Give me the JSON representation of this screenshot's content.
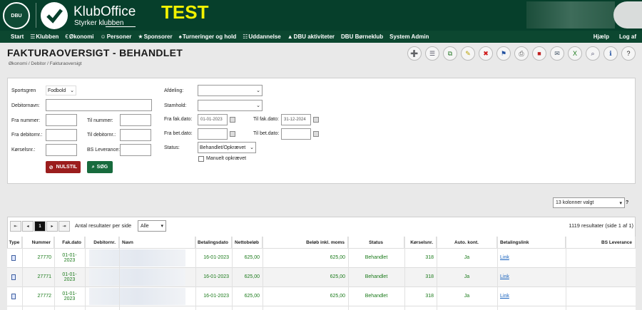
{
  "header": {
    "dbu_logo_text": "DBU",
    "app_name": "KlubOffice",
    "tagline": "Styrker klubben",
    "env_badge": "TEST"
  },
  "nav": {
    "items": [
      {
        "icon": "",
        "label": "Start"
      },
      {
        "icon": "☰",
        "label": "Klubben"
      },
      {
        "icon": "€",
        "label": "Økonomi"
      },
      {
        "icon": "☺",
        "label": "Personer"
      },
      {
        "icon": "★",
        "label": "Sponsorer"
      },
      {
        "icon": "♠",
        "label": "Turneringer og hold"
      },
      {
        "icon": "☷",
        "label": "Uddannelse"
      },
      {
        "icon": "▲",
        "label": "DBU aktiviteter"
      },
      {
        "icon": "",
        "label": "DBU Børneklub"
      },
      {
        "icon": "",
        "label": "System Admin"
      }
    ],
    "help": "Hjælp",
    "logout": "Log af"
  },
  "page": {
    "title": "FAKTURAOVERSIGT - BEHANDLET",
    "breadcrumb": "Økonomi / Debitor / Fakturaoversigt"
  },
  "toolbar": [
    {
      "icon": "add-icon",
      "glyph": "➕",
      "color": "#2a9a2a"
    },
    {
      "icon": "document-icon",
      "glyph": "☰",
      "color": "#556"
    },
    {
      "icon": "copy-icon",
      "glyph": "⧉",
      "color": "#2a7a2a"
    },
    {
      "icon": "edit-icon",
      "glyph": "✎",
      "color": "#b8a000"
    },
    {
      "icon": "delete-icon",
      "glyph": "✖",
      "color": "#d01818"
    },
    {
      "icon": "bookmark-icon",
      "glyph": "⚑",
      "color": "#2050a0"
    },
    {
      "icon": "print-icon",
      "glyph": "⎙",
      "color": "#555"
    },
    {
      "icon": "pdf-icon",
      "glyph": "■",
      "color": "#c02020"
    },
    {
      "icon": "email-icon",
      "glyph": "✉",
      "color": "#456"
    },
    {
      "icon": "excel-icon",
      "glyph": "X",
      "color": "#1a7a1a"
    },
    {
      "icon": "search-icon",
      "glyph": "⌕",
      "color": "#446"
    },
    {
      "icon": "info-icon",
      "glyph": "ℹ",
      "color": "#2050a0"
    },
    {
      "icon": "help-icon",
      "glyph": "?",
      "color": "#222"
    }
  ],
  "filters": {
    "sportsgren_label": "Sportsgren",
    "sportsgren_value": "Fodbold",
    "debitornavn_label": "Debitornavn:",
    "fra_nummer_label": "Fra nummer:",
    "til_nummer_label": "Til nummer:",
    "fra_debitornr_label": "Fra debitornr.:",
    "til_debitornr_label": "Til debitornr.:",
    "koerselsnr_label": "Kørselsnr.:",
    "bs_leverance_label": "BS Leverance:",
    "afdeling_label": "Afdeling:",
    "stamhold_label": "Stamhold:",
    "fra_fak_label": "Fra fak.dato:",
    "fra_fak_value": "01-01-2023",
    "til_fak_label": "Til fak.dato:",
    "til_fak_value": "31-12-2024",
    "fra_bet_label": "Fra bet.dato:",
    "til_bet_label": "Til bet.dato:",
    "status_label": "Status:",
    "status_value": "Behandlet/Opkrævet",
    "manuelt_label": "Manuelt opkrævet",
    "reset_button": "NULSTIL",
    "search_button": "SØG"
  },
  "columns_select": "13 kolonner valgt",
  "table": {
    "pager": {
      "first": "⇤",
      "prev": "◂",
      "page": "1",
      "next": "▸",
      "last": "⇥"
    },
    "per_page_label": "Antal resultater per side",
    "per_page_value": "Alle",
    "result_count": "1119 resultater (side 1 af 1)",
    "headers": [
      "Type",
      "Nummer",
      "Fak.dato",
      "Debitornr.",
      "Navn",
      "Betalingsdato",
      "Nettobeløb",
      "Beløb inkl. moms",
      "Status",
      "Kørselsnr.",
      "Auto. kont.",
      "Betalingslink",
      "BS Leverance"
    ],
    "rows": [
      {
        "nummer": "27770",
        "fakdato": "01-01-\n2023",
        "betdato": "16-01-2023",
        "netto": "625,00",
        "inkl": "625,00",
        "status": "Behandlet",
        "koersel": "318",
        "auto": "Ja",
        "link": "Link"
      },
      {
        "nummer": "27771",
        "fakdato": "01-01-\n2023",
        "betdato": "16-01-2023",
        "netto": "625,00",
        "inkl": "625,00",
        "status": "Behandlet",
        "koersel": "318",
        "auto": "Ja",
        "link": "Link"
      },
      {
        "nummer": "27772",
        "fakdato": "01-01-\n2023",
        "betdato": "16-01-2023",
        "netto": "625,00",
        "inkl": "625,00",
        "status": "Behandlet",
        "koersel": "318",
        "auto": "Ja",
        "link": "Link"
      }
    ]
  }
}
